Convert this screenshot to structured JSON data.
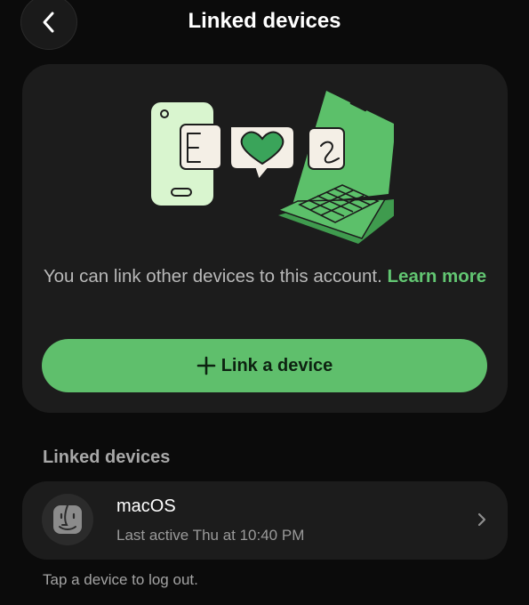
{
  "header": {
    "title": "Linked devices",
    "back_icon": "chevron-left-icon"
  },
  "intro": {
    "text": "You can link other devices to this account.",
    "learn_more": "Learn more"
  },
  "link_button": {
    "icon": "plus-icon",
    "label": "Link a device"
  },
  "section": {
    "label": "Linked devices"
  },
  "devices": [
    {
      "icon": "finder-icon",
      "name": "macOS",
      "status": "Last active Thu at 10:40 PM"
    }
  ],
  "footer": {
    "hint": "Tap a device to log out."
  },
  "colors": {
    "accent": "#62c672",
    "button": "#5fbf6c",
    "card": "#1c1c1c",
    "background": "#0b0b0b"
  }
}
